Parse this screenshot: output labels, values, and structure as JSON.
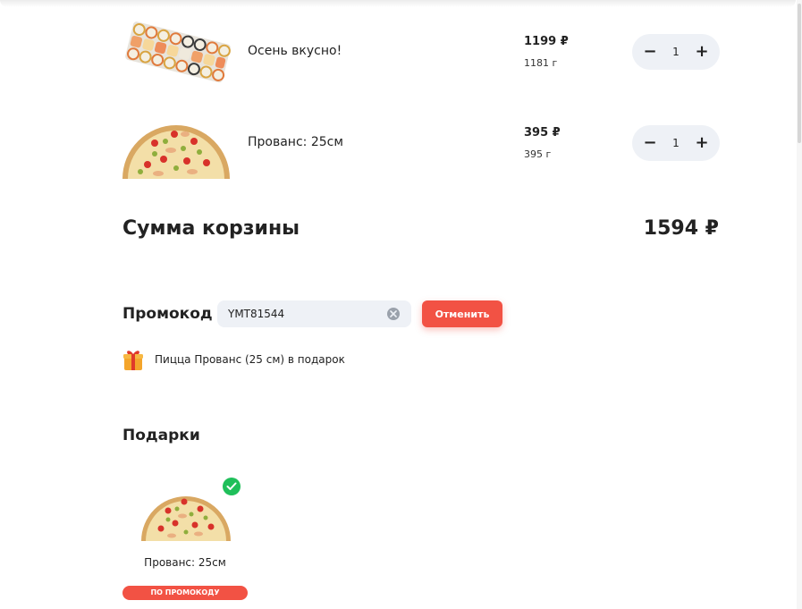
{
  "cart": {
    "items": [
      {
        "name": "Осень вкусно!",
        "price": "1199 ₽",
        "weight": "1181 г",
        "quantity": "1",
        "image": "sushi-set"
      },
      {
        "name": "Прованс: 25см",
        "price": "395 ₽",
        "weight": "395 г",
        "quantity": "1",
        "image": "pizza"
      }
    ],
    "stepper": {
      "minus": "−",
      "plus": "+"
    },
    "total_label": "Сумма корзины",
    "total_value": "1594 ₽"
  },
  "promo": {
    "label": "Промокод",
    "value": "YMT81544",
    "cancel_label": "Отменить",
    "gift_note": "Пицца Прованс (25 см) в подарок"
  },
  "gifts": {
    "title": "Подарки",
    "items": [
      {
        "name": "Прованс: 25см",
        "badge": "ПО ПРОМОКОДУ",
        "selected": true
      }
    ]
  },
  "colors": {
    "accent": "#f25244",
    "stepper_bg": "#eef1f6",
    "check": "#1fbf5a"
  }
}
